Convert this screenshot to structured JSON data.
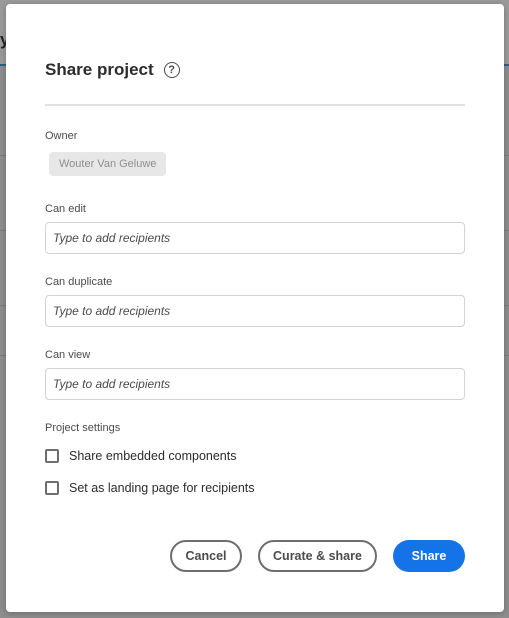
{
  "background": {
    "peek_left_text": "y"
  },
  "dialog": {
    "title": "Share project",
    "help_glyph": "?",
    "owner": {
      "label": "Owner",
      "name": "Wouter Van Geluwe"
    },
    "can_edit": {
      "label": "Can edit",
      "placeholder": "Type to add recipients",
      "value": ""
    },
    "can_duplicate": {
      "label": "Can duplicate",
      "placeholder": "Type to add recipients",
      "value": ""
    },
    "can_view": {
      "label": "Can view",
      "placeholder": "Type to add recipients",
      "value": ""
    },
    "project_settings": {
      "label": "Project settings",
      "options": [
        {
          "label": "Share embedded components",
          "checked": false
        },
        {
          "label": "Set as landing page for recipients",
          "checked": false
        }
      ]
    },
    "buttons": {
      "cancel": "Cancel",
      "curate_share": "Curate & share",
      "share": "Share"
    }
  },
  "colors": {
    "primary": "#1473e6",
    "overlay": "#8d8d8d",
    "chip_bg": "#e7e7e7"
  },
  "icons": {
    "help": "help-circle-icon"
  }
}
